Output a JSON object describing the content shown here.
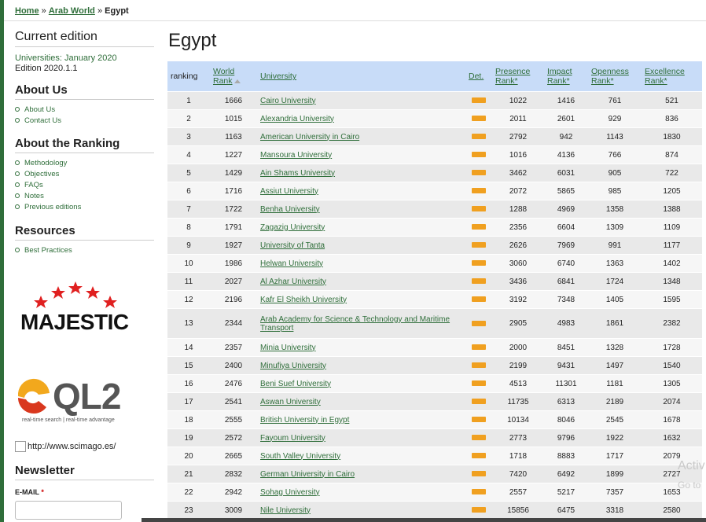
{
  "breadcrumb": {
    "home": "Home",
    "sep1": "»",
    "region": "Arab World",
    "sep2": "»",
    "current": "Egypt"
  },
  "sidebar": {
    "current_edition": "Current edition",
    "edition_line1": "Universities: January 2020",
    "edition_line2": "Edition 2020.1.1",
    "about_us": "About Us",
    "about_us_items": [
      "About Us",
      "Contact Us"
    ],
    "about_ranking": "About the Ranking",
    "about_ranking_items": [
      "Methodology",
      "Objectives",
      "FAQs",
      "Notes",
      "Previous editions"
    ],
    "resources": "Resources",
    "resources_items": [
      "Best Practices"
    ],
    "majestic": "MAJESTIC",
    "ql2": "QL2",
    "ql2_tagline": "real-time search | real-time advantage",
    "scimago_alt": "http://www.scimago.es/",
    "newsletter": "Newsletter",
    "email_label": "E-MAIL",
    "email_required": "*"
  },
  "page_title": "Egypt",
  "table": {
    "headers": {
      "ranking": "ranking",
      "world_rank_1": "World",
      "world_rank_2": "Rank",
      "university": "University",
      "det": "Det.",
      "presence_1": "Presence",
      "presence_2": "Rank*",
      "impact_1": "Impact",
      "impact_2": "Rank*",
      "openness_1": "Openness",
      "openness_2": "Rank*",
      "excellence_1": "Excellence",
      "excellence_2": "Rank*"
    },
    "rows": [
      {
        "rank": "1",
        "world": "1666",
        "name": "Cairo University",
        "presence": "1022",
        "impact": "1416",
        "openness": "761",
        "excellence": "521"
      },
      {
        "rank": "2",
        "world": "1015",
        "name": "Alexandria University",
        "presence": "2011",
        "impact": "2601",
        "openness": "929",
        "excellence": "836"
      },
      {
        "rank": "3",
        "world": "1163",
        "name": "American University in Cairo",
        "presence": "2792",
        "impact": "942",
        "openness": "1143",
        "excellence": "1830"
      },
      {
        "rank": "4",
        "world": "1227",
        "name": "Mansoura University",
        "presence": "1016",
        "impact": "4136",
        "openness": "766",
        "excellence": "874"
      },
      {
        "rank": "5",
        "world": "1429",
        "name": "Ain Shams University",
        "presence": "3462",
        "impact": "6031",
        "openness": "905",
        "excellence": "722"
      },
      {
        "rank": "6",
        "world": "1716",
        "name": "Assiut University",
        "presence": "2072",
        "impact": "5865",
        "openness": "985",
        "excellence": "1205"
      },
      {
        "rank": "7",
        "world": "1722",
        "name": "Benha University",
        "presence": "1288",
        "impact": "4969",
        "openness": "1358",
        "excellence": "1388"
      },
      {
        "rank": "8",
        "world": "1791",
        "name": "Zagazig University",
        "presence": "2356",
        "impact": "6604",
        "openness": "1309",
        "excellence": "1109"
      },
      {
        "rank": "9",
        "world": "1927",
        "name": "University of Tanta",
        "presence": "2626",
        "impact": "7969",
        "openness": "991",
        "excellence": "1177"
      },
      {
        "rank": "10",
        "world": "1986",
        "name": "Helwan University",
        "presence": "3060",
        "impact": "6740",
        "openness": "1363",
        "excellence": "1402"
      },
      {
        "rank": "11",
        "world": "2027",
        "name": "Al Azhar University",
        "presence": "3436",
        "impact": "6841",
        "openness": "1724",
        "excellence": "1348"
      },
      {
        "rank": "12",
        "world": "2196",
        "name": "Kafr El Sheikh University",
        "presence": "3192",
        "impact": "7348",
        "openness": "1405",
        "excellence": "1595"
      },
      {
        "rank": "13",
        "world": "2344",
        "name": "Arab Academy for Science & Technology and Maritime Transport",
        "presence": "2905",
        "impact": "4983",
        "openness": "1861",
        "excellence": "2382"
      },
      {
        "rank": "14",
        "world": "2357",
        "name": "Minia University",
        "presence": "2000",
        "impact": "8451",
        "openness": "1328",
        "excellence": "1728"
      },
      {
        "rank": "15",
        "world": "2400",
        "name": "Minufiya University",
        "presence": "2199",
        "impact": "9431",
        "openness": "1497",
        "excellence": "1540"
      },
      {
        "rank": "16",
        "world": "2476",
        "name": "Beni Suef University",
        "presence": "4513",
        "impact": "11301",
        "openness": "1181",
        "excellence": "1305"
      },
      {
        "rank": "17",
        "world": "2541",
        "name": "Aswan University",
        "presence": "11735",
        "impact": "6313",
        "openness": "2189",
        "excellence": "2074"
      },
      {
        "rank": "18",
        "world": "2555",
        "name": "British University in Egypt",
        "presence": "10134",
        "impact": "8046",
        "openness": "2545",
        "excellence": "1678"
      },
      {
        "rank": "19",
        "world": "2572",
        "name": "Fayoum University",
        "presence": "2773",
        "impact": "9796",
        "openness": "1922",
        "excellence": "1632"
      },
      {
        "rank": "20",
        "world": "2665",
        "name": "South Valley University",
        "presence": "1718",
        "impact": "8883",
        "openness": "1717",
        "excellence": "2079"
      },
      {
        "rank": "21",
        "world": "2832",
        "name": "German University in Cairo",
        "presence": "7420",
        "impact": "6492",
        "openness": "1899",
        "excellence": "2727"
      },
      {
        "rank": "22",
        "world": "2942",
        "name": "Sohag University",
        "presence": "2557",
        "impact": "5217",
        "openness": "7357",
        "excellence": "1653"
      },
      {
        "rank": "23",
        "world": "3009",
        "name": "Nile University",
        "presence": "15856",
        "impact": "6475",
        "openness": "3318",
        "excellence": "2580"
      }
    ]
  },
  "overlay": {
    "activate": "Activ",
    "goto": "Go to"
  },
  "colors": {
    "accent": "#2f6e3a",
    "header_bg": "#c8dcf8",
    "det_icon": "#f0a020"
  }
}
